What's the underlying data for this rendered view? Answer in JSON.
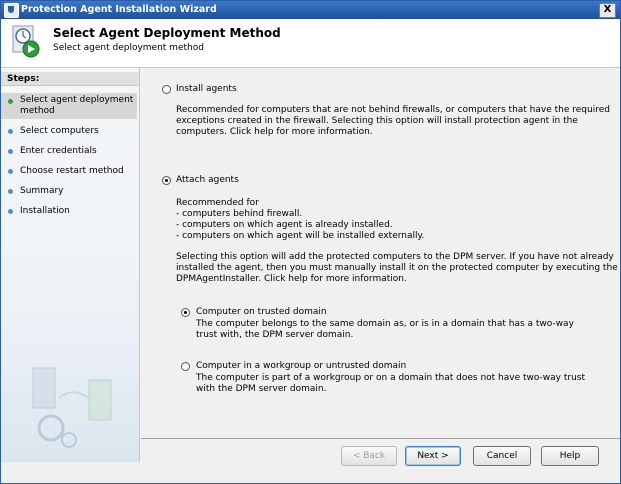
{
  "window": {
    "title": "Protection Agent Installation Wizard",
    "close_glyph": "X"
  },
  "header": {
    "title": "Select Agent Deployment Method",
    "subtitle": "Select agent deployment method",
    "icon": "wizard-clock-play-icon"
  },
  "sidebar": {
    "heading": "Steps:",
    "items": [
      {
        "label": "Select agent deployment method",
        "active": true
      },
      {
        "label": "Select computers"
      },
      {
        "label": "Enter credentials"
      },
      {
        "label": "Choose restart method"
      },
      {
        "label": "Summary"
      },
      {
        "label": "Installation"
      }
    ]
  },
  "options": {
    "install": {
      "label": "Install agents",
      "selected": false,
      "desc": "Recommended for computers that are not behind firewalls, or computers that have the required exceptions created in the firewall. Selecting this option will install protection agent in the computers. Click help for more information."
    },
    "attach": {
      "label": "Attach agents",
      "selected": true,
      "rec_head": "Recommended for",
      "rec_1": "- computers behind firewall.",
      "rec_2": "- computers on which agent is already installed.",
      "rec_3": "- computers on which agent will be installed externally.",
      "desc": "Selecting this option will add the protected computers to the DPM server. If you have not already installed the agent, then you must manually install it on the protected computer by executing the DPMAgentInstaller. Click help for more information."
    },
    "trusted": {
      "label": "Computer on trusted domain",
      "selected": true,
      "desc": "The computer belongs to the same domain as, or is in a domain that has a two-way trust with, the DPM server domain."
    },
    "workgroup": {
      "label": "Computer in a workgroup or untrusted domain",
      "selected": false,
      "desc": "The computer is part of a workgroup or on a domain that does not have two-way trust with the DPM server domain."
    }
  },
  "buttons": {
    "back": "< Back",
    "next": "Next >",
    "cancel": "Cancel",
    "help": "Help"
  }
}
